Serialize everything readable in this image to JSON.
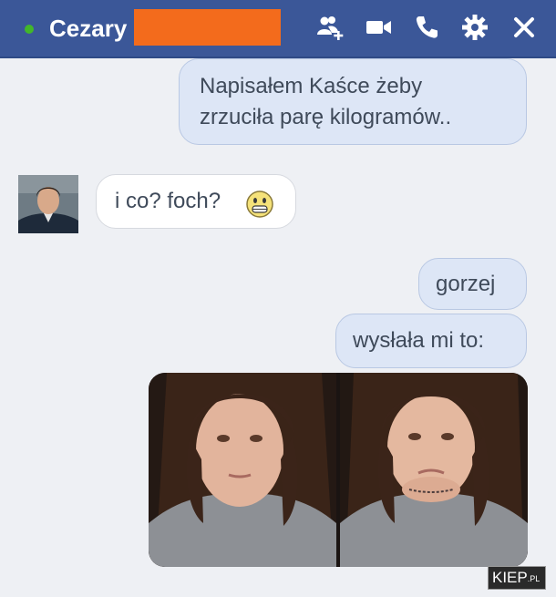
{
  "header": {
    "contact_name": "Cezary",
    "status": "online",
    "icons": [
      "add-friend-icon",
      "video-call-icon",
      "phone-icon",
      "gear-icon",
      "close-icon"
    ],
    "colors": {
      "bar": "#3b5798",
      "status_dot": "#42b72a",
      "redaction": "#f36b1c"
    }
  },
  "messages": [
    {
      "from": "me",
      "text_line1": "Napisałem Kaśce żeby",
      "text_line2": "zrzuciła parę kilogramów.."
    },
    {
      "from": "contact",
      "text": "i co? foch?",
      "emoji": "smiley-emoji"
    },
    {
      "from": "me",
      "text": "gorzej"
    },
    {
      "from": "me",
      "text": "wysłała mi to:"
    },
    {
      "from": "me",
      "attachment": "photo-collage"
    }
  ],
  "watermark": {
    "main": "KIEP",
    "suffix": ".PL"
  }
}
